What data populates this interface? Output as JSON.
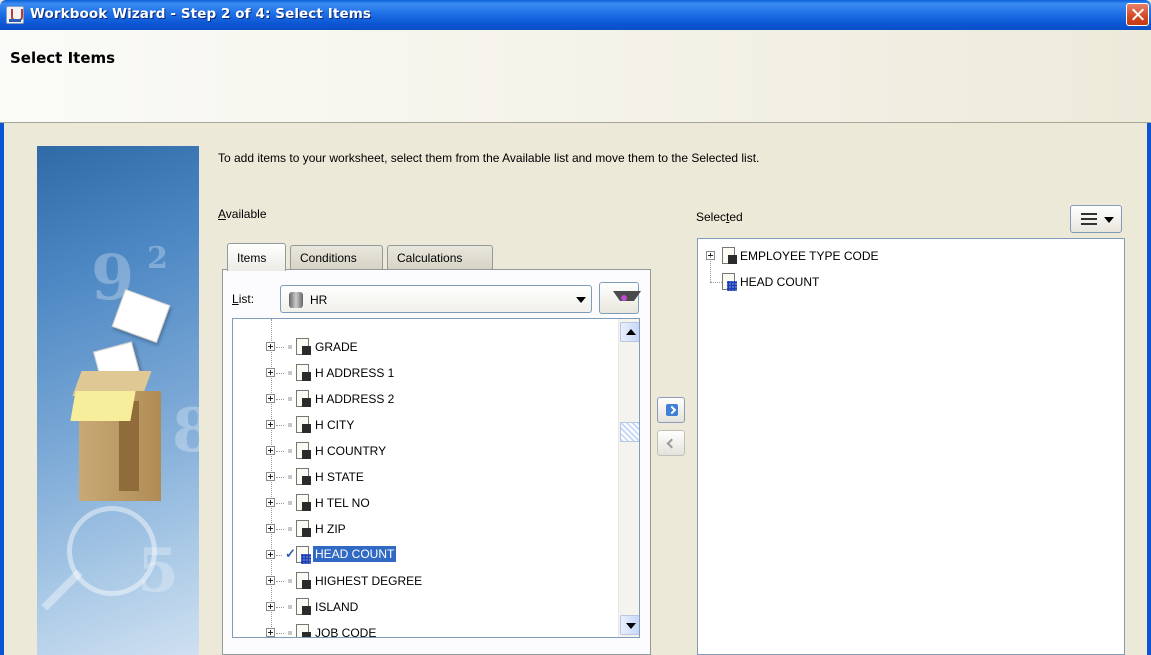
{
  "window": {
    "title": "Workbook Wizard - Step 2 of 4: Select Items"
  },
  "header": {
    "page_title": "Select Items"
  },
  "main": {
    "instructions": "To add items to your worksheet, select them from the Available list and move them to the Selected list.",
    "available_label_first": "A",
    "available_label_rest": "vailable",
    "selected_label_start": "Selec",
    "selected_label_underlined": "t",
    "selected_label_end": "ed"
  },
  "tabs": [
    {
      "label": "Items",
      "active": true
    },
    {
      "label": "Conditions",
      "active": false
    },
    {
      "label": "Calculations",
      "active": false
    }
  ],
  "list_selector": {
    "label_first": "L",
    "label_rest": "ist:",
    "value": "HR"
  },
  "available_items": [
    {
      "label": "GRADE",
      "type": "item",
      "checked": false,
      "selected": false
    },
    {
      "label": "H ADDRESS 1",
      "type": "item",
      "checked": false,
      "selected": false
    },
    {
      "label": "H ADDRESS 2",
      "type": "item",
      "checked": false,
      "selected": false
    },
    {
      "label": "H CITY",
      "type": "item",
      "checked": false,
      "selected": false
    },
    {
      "label": "H COUNTRY",
      "type": "item",
      "checked": false,
      "selected": false
    },
    {
      "label": "H STATE",
      "type": "item",
      "checked": false,
      "selected": false
    },
    {
      "label": "H TEL NO",
      "type": "item",
      "checked": false,
      "selected": false
    },
    {
      "label": "H ZIP",
      "type": "item",
      "checked": false,
      "selected": false
    },
    {
      "label": "HEAD COUNT",
      "type": "measure",
      "checked": true,
      "selected": true
    },
    {
      "label": "HIGHEST DEGREE",
      "type": "item",
      "checked": false,
      "selected": false
    },
    {
      "label": "ISLAND",
      "type": "item",
      "checked": false,
      "selected": false
    },
    {
      "label": "JOB CODE",
      "type": "item",
      "checked": false,
      "selected": false
    }
  ],
  "selected_items": [
    {
      "label": "EMPLOYEE TYPE CODE",
      "type": "item"
    },
    {
      "label": "HEAD COUNT",
      "type": "measure"
    }
  ],
  "colors": {
    "titlebar": "#0b55d3",
    "selection": "#316ac5",
    "accent": "#3f7fd6"
  }
}
